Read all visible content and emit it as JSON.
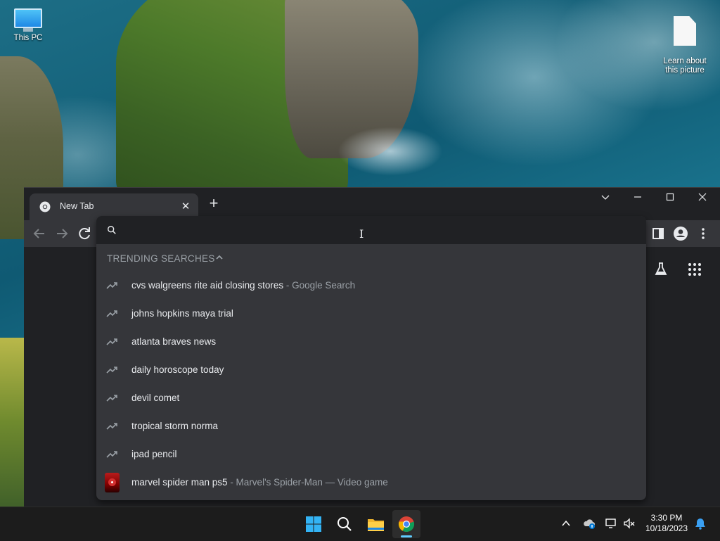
{
  "desktop": {
    "icons": [
      {
        "label": "This PC",
        "icon": "computer-icon"
      },
      {
        "label": "Learn about\nthis picture",
        "icon": "file-icon"
      }
    ]
  },
  "browser": {
    "tab": {
      "title": "New Tab",
      "favicon": "chrome-icon"
    },
    "new_tab_symbol": "+",
    "window_controls": [
      "chevron-down-icon",
      "minimize-icon",
      "maximize-icon",
      "close-icon"
    ]
  },
  "omnibox": {
    "query": "",
    "section_header": "TRENDING SEARCHES",
    "suggestions": [
      {
        "text": "cvs walgreens rite aid closing stores",
        "sub": " - Google Search",
        "icon": "trending-icon"
      },
      {
        "text": "johns hopkins maya trial",
        "sub": "",
        "icon": "trending-icon"
      },
      {
        "text": "atlanta braves news",
        "sub": "",
        "icon": "trending-icon"
      },
      {
        "text": "daily horoscope today",
        "sub": "",
        "icon": "trending-icon"
      },
      {
        "text": "devil comet",
        "sub": "",
        "icon": "trending-icon"
      },
      {
        "text": "tropical storm norma",
        "sub": "",
        "icon": "trending-icon"
      },
      {
        "text": "ipad pencil",
        "sub": "",
        "icon": "trending-icon"
      },
      {
        "text": "marvel spider man ps5",
        "sub": " - Marvel's Spider-Man — Video game",
        "icon": "game-thumbnail"
      }
    ]
  },
  "taskbar": {
    "apps": [
      "windows-start-icon",
      "search-icon",
      "file-explorer-icon",
      "chrome-icon"
    ],
    "clock": {
      "time": "3:30 PM",
      "date": "10/18/2023"
    }
  },
  "colors": {
    "window_bg": "#202124",
    "toolbar_bg": "#35363a",
    "text_primary": "#e8eaed",
    "text_secondary": "#9aa0a6",
    "taskbar_bg": "#1c1c1c",
    "accent": "#60cdff"
  }
}
